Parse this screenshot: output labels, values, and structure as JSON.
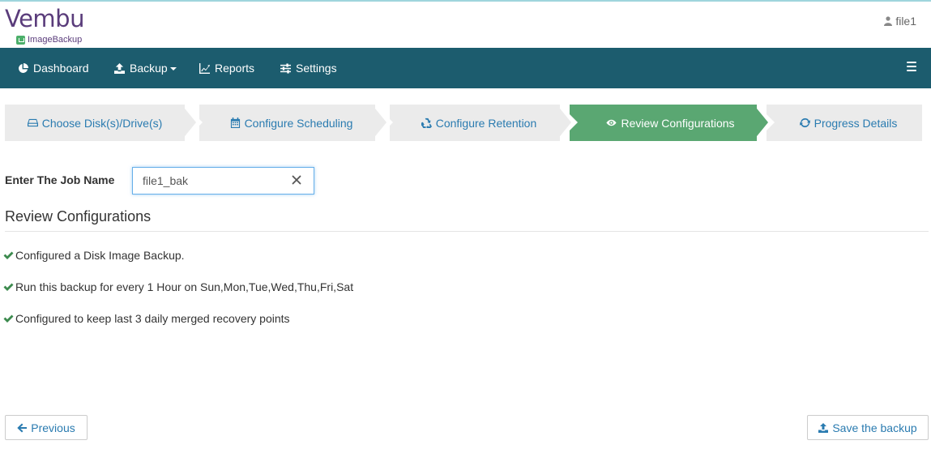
{
  "brand": {
    "name": "Vembu",
    "product": "ImageBackup",
    "color": "#5a3c7b"
  },
  "user": {
    "name": "file1"
  },
  "nav": {
    "background": "#1c5c6e",
    "items": [
      {
        "label": "Dashboard",
        "icon": "pie-chart-icon"
      },
      {
        "label": "Backup",
        "icon": "upload-icon",
        "dropdown": true
      },
      {
        "label": "Reports",
        "icon": "line-chart-icon"
      },
      {
        "label": "Settings",
        "icon": "sliders-icon"
      }
    ],
    "menu_icon": "hamburger-icon"
  },
  "wizard": {
    "steps": [
      {
        "label": "Choose Disk(s)/Drive(s)",
        "icon": "hard-drive-icon",
        "active": false
      },
      {
        "label": "Configure Scheduling",
        "icon": "calendar-icon",
        "active": false
      },
      {
        "label": "Configure Retention",
        "icon": "recycle-icon",
        "active": false
      },
      {
        "label": "Review Configurations",
        "icon": "eye-icon",
        "active": true
      },
      {
        "label": "Progress Details",
        "icon": "refresh-icon",
        "active": false
      }
    ],
    "active_color": "#5aa772"
  },
  "job": {
    "label": "Enter The Job Name",
    "value": "file1_bak"
  },
  "review": {
    "title": "Review Configurations",
    "items": [
      "Configured a Disk Image Backup.",
      "Run this backup for every 1 Hour on Sun,Mon,Tue,Wed,Thu,Fri,Sat",
      "Configured to keep last 3 daily merged recovery points"
    ],
    "check_color": "#3c8a4e"
  },
  "actions": {
    "previous_label": "Previous",
    "save_label": "Save the backup"
  }
}
